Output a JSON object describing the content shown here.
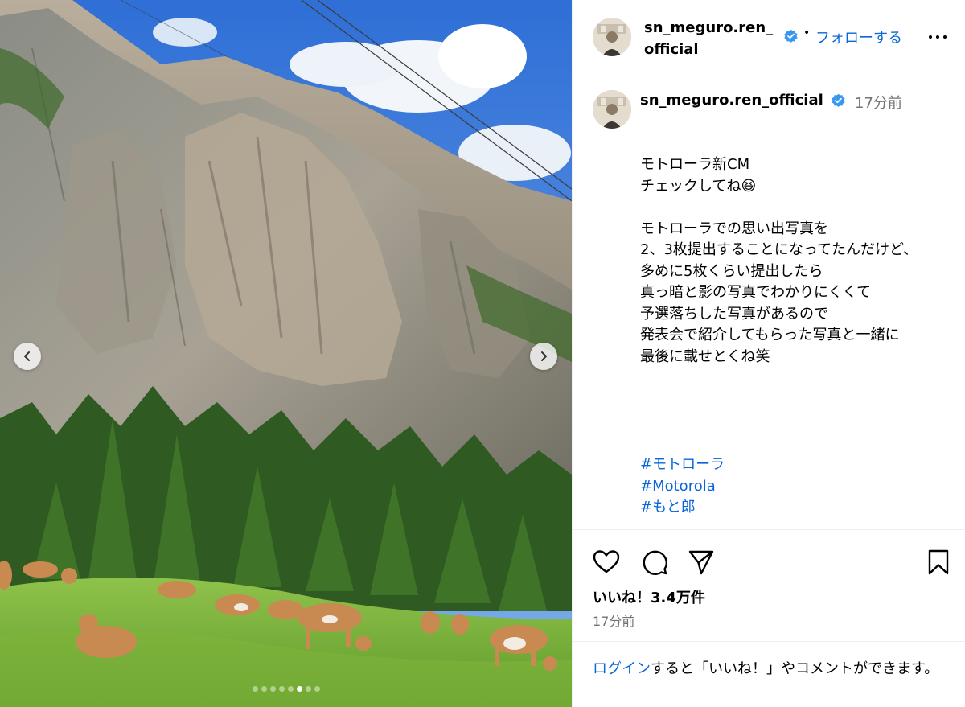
{
  "post": {
    "username": "sn_meguro.ren_official",
    "header_username": "sn_meguro.ren_\nofficial",
    "verified": true,
    "follow_label": "フォローする",
    "separator": "•",
    "time_ago": "17分前",
    "caption": "モトローラ新CM\nチェックしてね😆\n\nモトローラでの思い出写真を\n2、3枚提出することになってたんだけど、\n多めに5枚くらい提出したら\n真っ暗と影の写真でわかりにくくて\n予選落ちした写真があるので\n発表会で紹介してもらった写真と一緒に\n最後に載せとくね笑",
    "hashtags": [
      "#モトローラ",
      "#Motorola",
      "#もと郎"
    ],
    "likes_text": "いいね！3.4万件",
    "post_time": "17分前"
  },
  "carousel": {
    "total": 8,
    "active_index": 5
  },
  "login_prompt": {
    "link": "ログイン",
    "rest": "すると「いいね！」やコメントができます。"
  },
  "icons": {
    "verified": "verified-badge-icon",
    "more": "more-options-icon",
    "like": "heart-icon",
    "comment": "comment-icon",
    "share": "share-icon",
    "save": "bookmark-icon",
    "prev": "chevron-left-icon",
    "next": "chevron-right-icon"
  },
  "colors": {
    "link_blue": "#0a66d8",
    "verified_blue": "#3897f0",
    "muted_gray": "#737373"
  }
}
